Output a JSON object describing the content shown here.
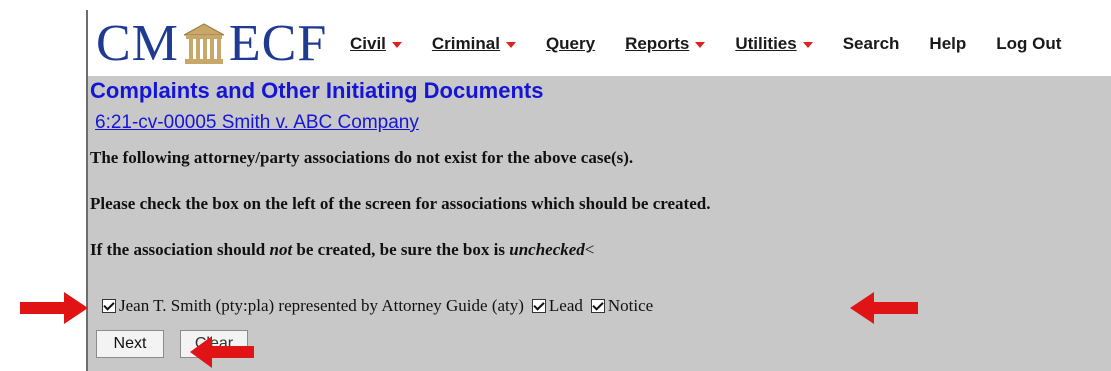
{
  "header": {
    "logo": {
      "left": "CM",
      "right": "ECF"
    },
    "menu": [
      {
        "label": "Civil",
        "has_dropdown": true
      },
      {
        "label": "Criminal",
        "has_dropdown": true
      },
      {
        "label": "Query",
        "has_dropdown": false
      },
      {
        "label": "Reports",
        "has_dropdown": true
      },
      {
        "label": "Utilities",
        "has_dropdown": true
      },
      {
        "label": "Search",
        "has_dropdown": false
      },
      {
        "label": "Help",
        "has_dropdown": false
      },
      {
        "label": "Log Out",
        "has_dropdown": false
      }
    ]
  },
  "page": {
    "title": "Complaints and Other Initiating Documents",
    "case_link": "6:21-cv-00005 Smith v. ABC Company",
    "message1": "The following attorney/party associations do not exist for the above case(s).",
    "message2": "Please check the box on the left of the screen for associations which should be created.",
    "message3_a": "If the association should ",
    "message3_b": "not",
    "message3_c": " be created, be sure the box is ",
    "message3_d": "unchecked",
    "message3_e": "<"
  },
  "association": {
    "text": "Jean T. Smith (pty:pla) represented by Attorney Guide (aty)",
    "lead_label": "Lead",
    "notice_label": "Notice",
    "checked": true,
    "lead_checked": true,
    "notice_checked": true
  },
  "buttons": {
    "next": "Next",
    "clear": "Clear"
  },
  "colors": {
    "logo": "#1f3a93",
    "title": "#1515d6",
    "caret": "#e0201b",
    "arrow": "#e01414",
    "background": "#c8c8c8"
  }
}
